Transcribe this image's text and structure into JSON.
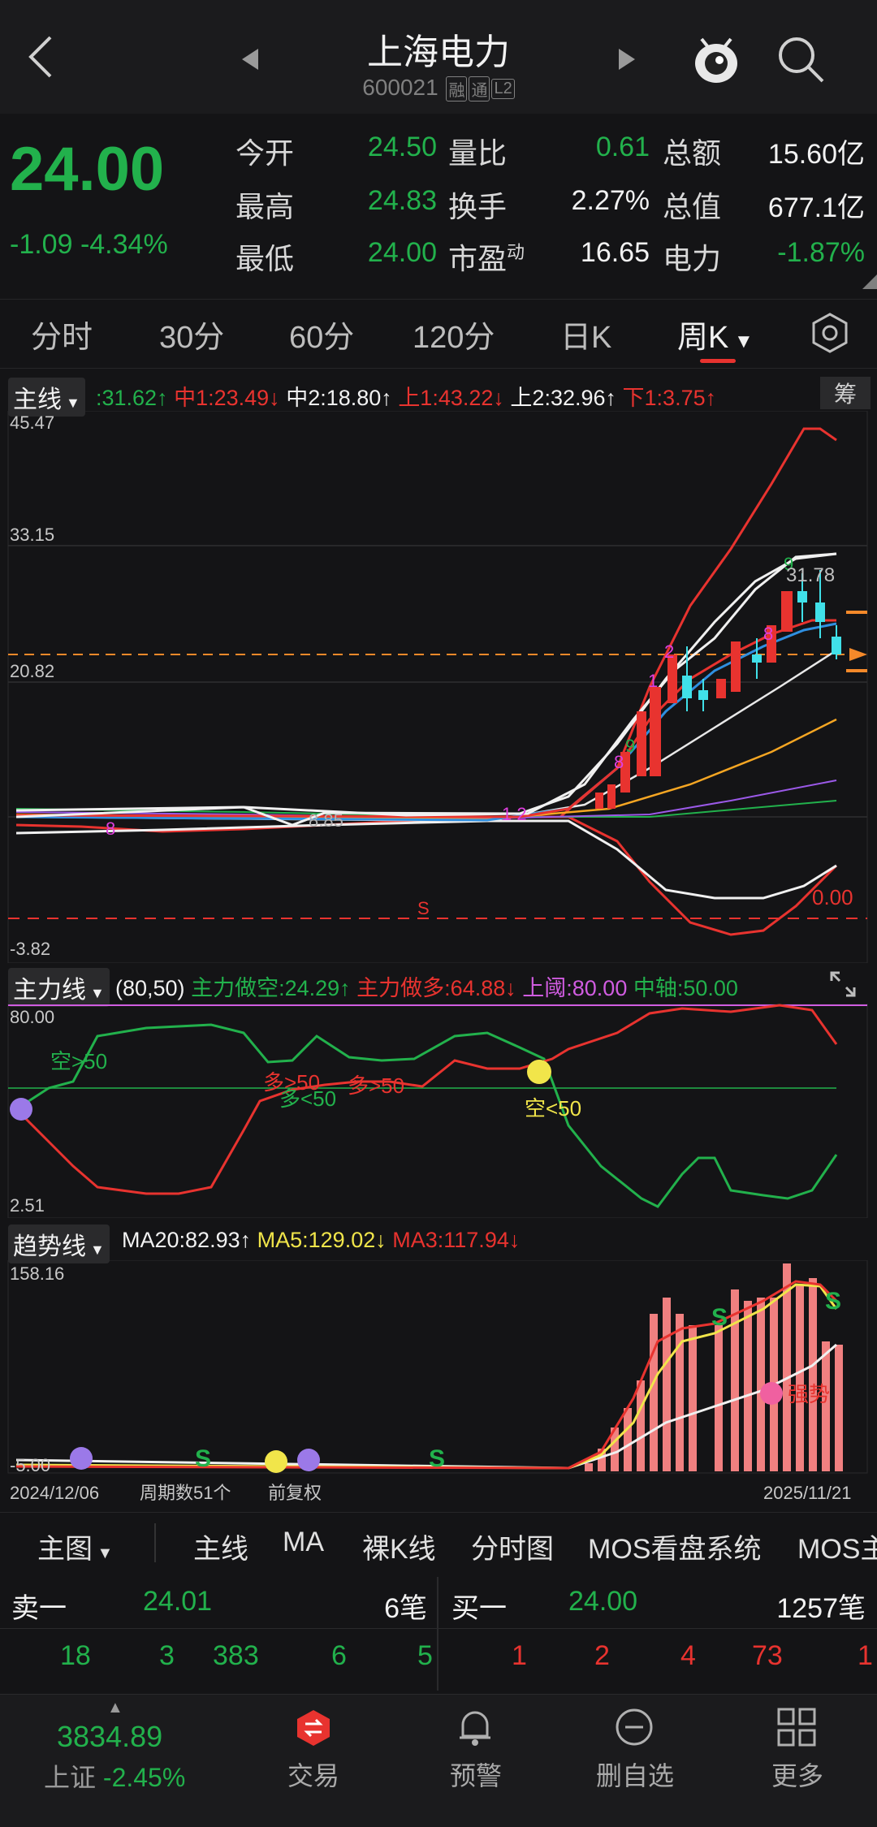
{
  "header": {
    "title": "上海电力",
    "code": "600021",
    "tags": [
      "融",
      "通",
      "L2"
    ]
  },
  "quote": {
    "price": "24.00",
    "change": "-1.09",
    "change_pct": "-4.34%",
    "rows": [
      {
        "l1": "今开",
        "v1": "24.50",
        "l2": "量比",
        "v2": "0.61",
        "l3": "总额",
        "v3": "15.60亿"
      },
      {
        "l1": "最高",
        "v1": "24.83",
        "l2": "换手",
        "v2": "2.27%",
        "l3": "总值",
        "v3": "677.1亿"
      },
      {
        "l1": "最低",
        "v1": "24.00",
        "l2": "市盈",
        "l2sup": "动",
        "v2": "16.65",
        "l3": "电力",
        "v3": "-1.87%"
      }
    ]
  },
  "period_tabs": [
    "分时",
    "30分",
    "60分",
    "120分",
    "日K",
    "周K"
  ],
  "main_indicator": {
    "button": "主线",
    "values": [
      {
        "text": ":31.62↑",
        "color": "green"
      },
      {
        "text": "中1:23.49↓",
        "color": "red"
      },
      {
        "text": "中2:18.80↑",
        "color": "white"
      },
      {
        "text": "上1:43.22↓",
        "color": "red"
      },
      {
        "text": "上2:32.96↑",
        "color": "white"
      },
      {
        "text": "下1:3.75↑",
        "color": "red"
      },
      {
        "text": "下",
        "color": "white"
      }
    ],
    "right_badge": "筹",
    "y_labels": [
      "45.47",
      "33.15",
      "20.82",
      "-3.82"
    ],
    "annotations": {
      "zero": "0.00",
      "high_label": "31.78",
      "mid_label": "8.85",
      "s_mark": "S"
    }
  },
  "mainforce_indicator": {
    "button": "主力线",
    "params": "(80,50)",
    "short": "主力做空:24.29↑",
    "long": "主力做多:64.88↓",
    "upper": "上阈:80.00",
    "axis": "中轴:50.00",
    "y_top": "80.00",
    "y_bottom": "2.51",
    "labels": [
      "空>50",
      "多>50",
      "多<50",
      "多>50",
      "空<50"
    ]
  },
  "trend_indicator": {
    "button": "趋势线",
    "ma20": "MA20:82.93↑",
    "ma5": "MA5:129.02↓",
    "ma3": "MA3:117.94↓",
    "y_top": "158.16",
    "y_bottom": "-5.00",
    "date_start": "2024/12/06",
    "period_count": "周期数51个",
    "adjust": "前复权",
    "date_end": "2025/11/21",
    "strong_label": "强势"
  },
  "chart_tabs": [
    "主图",
    "主线",
    "MA",
    "裸K线",
    "分时图",
    "MOS看盘系统",
    "MOS主"
  ],
  "orderbook": {
    "sell1_label": "卖一",
    "sell1_price": "24.01",
    "sell1_count": "6笔",
    "buy1_label": "买一",
    "buy1_price": "24.00",
    "buy1_count": "1257笔",
    "sell_queue": [
      "18",
      "3",
      "383",
      "6",
      "5"
    ],
    "buy_queue": [
      "1",
      "2",
      "4",
      "73",
      "1"
    ]
  },
  "tabbar": {
    "index_value": "3834.89",
    "index_name": "上证",
    "index_change": "-2.45%",
    "items": [
      "交易",
      "预警",
      "删自选",
      "更多"
    ]
  },
  "colors": {
    "up": "#e8332f",
    "down": "#22b14c",
    "accent": "#e8332f",
    "background": "#141416"
  }
}
